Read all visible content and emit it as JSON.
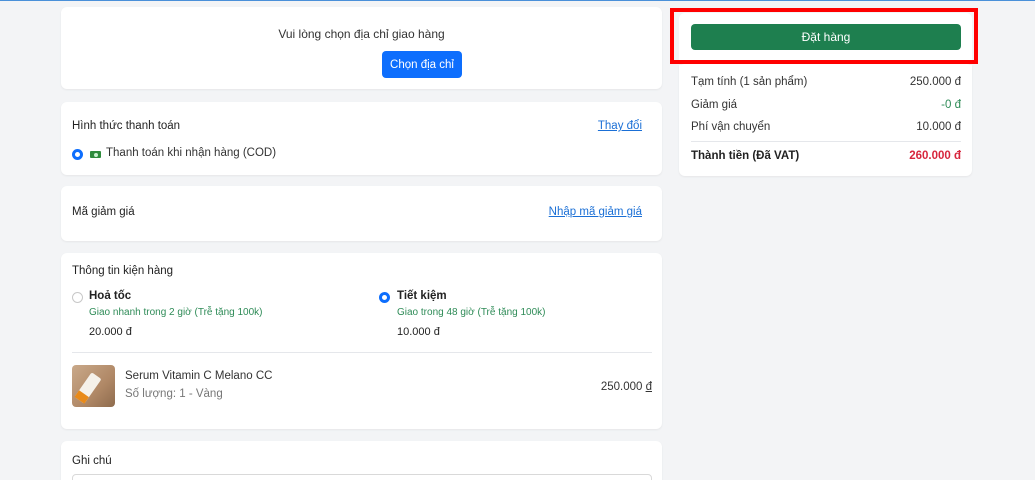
{
  "address": {
    "prompt": "Vui lòng chọn địa chỉ giao hàng",
    "choose_button": "Chọn địa chỉ"
  },
  "payment": {
    "title": "Hình thức thanh toán",
    "change_link": "Thay đổi",
    "method_label": "Thanh toán khi nhận hàng (COD)",
    "method_icon": "cash-icon"
  },
  "coupon": {
    "title": "Mã giảm giá",
    "enter_link": "Nhập mã giảm giá"
  },
  "package": {
    "title": "Thông tin kiện hàng",
    "shipping_options": [
      {
        "name": "Hoả tốc",
        "desc": "Giao nhanh trong 2 giờ (Trễ tặng 100k)",
        "price": "20.000 đ",
        "selected": false
      },
      {
        "name": "Tiết kiệm",
        "desc": "Giao trong 48 giờ (Trễ tặng 100k)",
        "price": "10.000 đ",
        "selected": true
      }
    ],
    "product": {
      "name": "Serum Vitamin C Melano CC",
      "meta": "Số lượng: 1 - Vàng",
      "price": "250.000 ",
      "currency": "đ"
    }
  },
  "note": {
    "title": "Ghi chú"
  },
  "order": {
    "button_label": "Đặt hàng"
  },
  "summary": {
    "subtotal_label": "Tạm tính (1 sản phẩm)",
    "subtotal_value": "250.000 đ",
    "discount_label": "Giảm giá",
    "discount_value": "-0 đ",
    "shipping_label": "Phí vận chuyển",
    "shipping_value": "10.000 đ",
    "total_label": "Thành tiền (Đã VAT)",
    "total_value": "260.000 đ"
  },
  "colors": {
    "primary_blue": "#0d6efd",
    "order_green": "#1e7f4f",
    "total_red": "#d7263d",
    "highlight_red": "#ff0000"
  }
}
